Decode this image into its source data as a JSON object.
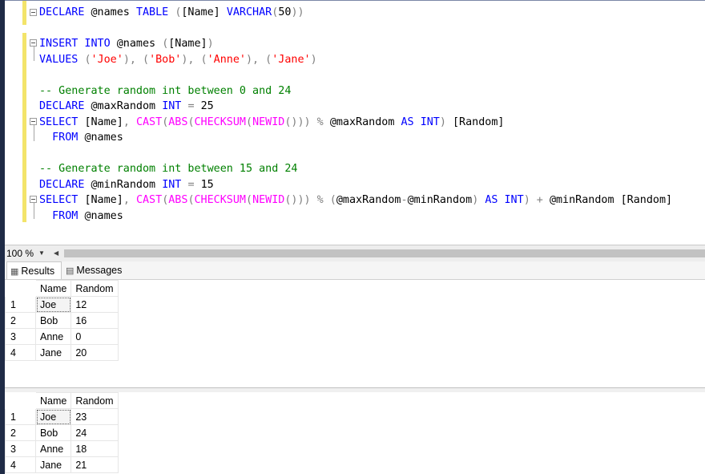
{
  "editor": {
    "lines": [
      [
        {
          "t": "DECLARE ",
          "c": "kw"
        },
        {
          "t": "@names ",
          "c": "ids"
        },
        {
          "t": "TABLE ",
          "c": "kw"
        },
        {
          "t": "(",
          "c": "op"
        },
        {
          "t": "[Name] ",
          "c": "ids"
        },
        {
          "t": "VARCHAR",
          "c": "kw"
        },
        {
          "t": "(",
          "c": "op"
        },
        {
          "t": "50",
          "c": "ids"
        },
        {
          "t": "))",
          "c": "op"
        }
      ],
      [],
      [
        {
          "t": "INSERT INTO ",
          "c": "kw"
        },
        {
          "t": "@names ",
          "c": "ids"
        },
        {
          "t": "(",
          "c": "op"
        },
        {
          "t": "[Name]",
          "c": "ids"
        },
        {
          "t": ")",
          "c": "op"
        }
      ],
      [
        {
          "t": "VALUES ",
          "c": "kw"
        },
        {
          "t": "(",
          "c": "op"
        },
        {
          "t": "'Joe'",
          "c": "str"
        },
        {
          "t": "), (",
          "c": "op"
        },
        {
          "t": "'Bob'",
          "c": "str"
        },
        {
          "t": "), (",
          "c": "op"
        },
        {
          "t": "'Anne'",
          "c": "str"
        },
        {
          "t": "), (",
          "c": "op"
        },
        {
          "t": "'Jane'",
          "c": "str"
        },
        {
          "t": ")",
          "c": "op"
        }
      ],
      [],
      [
        {
          "t": "-- Generate random int between 0 and 24",
          "c": "cm"
        }
      ],
      [
        {
          "t": "DECLARE ",
          "c": "kw"
        },
        {
          "t": "@maxRandom ",
          "c": "ids"
        },
        {
          "t": "INT ",
          "c": "kw"
        },
        {
          "t": "= ",
          "c": "op"
        },
        {
          "t": "25",
          "c": "ids"
        }
      ],
      [
        {
          "t": "SELECT ",
          "c": "kw"
        },
        {
          "t": "[Name]",
          "c": "ids"
        },
        {
          "t": ", ",
          "c": "op"
        },
        {
          "t": "CAST",
          "c": "fn"
        },
        {
          "t": "(",
          "c": "op"
        },
        {
          "t": "ABS",
          "c": "fn"
        },
        {
          "t": "(",
          "c": "op"
        },
        {
          "t": "CHECKSUM",
          "c": "fn"
        },
        {
          "t": "(",
          "c": "op"
        },
        {
          "t": "NEWID",
          "c": "fn"
        },
        {
          "t": "())) % ",
          "c": "op"
        },
        {
          "t": "@maxRandom ",
          "c": "ids"
        },
        {
          "t": "AS ",
          "c": "kw"
        },
        {
          "t": "INT",
          "c": "kw"
        },
        {
          "t": ") ",
          "c": "op"
        },
        {
          "t": "[Random]",
          "c": "ids"
        }
      ],
      [
        {
          "t": "  FROM ",
          "c": "kw"
        },
        {
          "t": "@names",
          "c": "ids"
        }
      ],
      [],
      [
        {
          "t": "-- Generate random int between 15 and 24",
          "c": "cm"
        }
      ],
      [
        {
          "t": "DECLARE ",
          "c": "kw"
        },
        {
          "t": "@minRandom ",
          "c": "ids"
        },
        {
          "t": "INT ",
          "c": "kw"
        },
        {
          "t": "= ",
          "c": "op"
        },
        {
          "t": "15",
          "c": "ids"
        }
      ],
      [
        {
          "t": "SELECT ",
          "c": "kw"
        },
        {
          "t": "[Name]",
          "c": "ids"
        },
        {
          "t": ", ",
          "c": "op"
        },
        {
          "t": "CAST",
          "c": "fn"
        },
        {
          "t": "(",
          "c": "op"
        },
        {
          "t": "ABS",
          "c": "fn"
        },
        {
          "t": "(",
          "c": "op"
        },
        {
          "t": "CHECKSUM",
          "c": "fn"
        },
        {
          "t": "(",
          "c": "op"
        },
        {
          "t": "NEWID",
          "c": "fn"
        },
        {
          "t": "())) % (",
          "c": "op"
        },
        {
          "t": "@maxRandom",
          "c": "ids"
        },
        {
          "t": "-",
          "c": "op"
        },
        {
          "t": "@minRandom",
          "c": "ids"
        },
        {
          "t": ") ",
          "c": "op"
        },
        {
          "t": "AS ",
          "c": "kw"
        },
        {
          "t": "INT",
          "c": "kw"
        },
        {
          "t": ") + ",
          "c": "op"
        },
        {
          "t": "@minRandom ",
          "c": "ids"
        },
        {
          "t": "[Random]",
          "c": "ids"
        }
      ],
      [
        {
          "t": "  FROM ",
          "c": "kw"
        },
        {
          "t": "@names",
          "c": "ids"
        }
      ]
    ]
  },
  "zoom": {
    "value": "100 %"
  },
  "tabs": {
    "results_label": "Results",
    "messages_label": "Messages",
    "results_icon": "grid-icon",
    "messages_icon": "messages-icon"
  },
  "results": [
    {
      "columns": [
        "Name",
        "Random"
      ],
      "rows": [
        [
          "1",
          "Joe",
          "12"
        ],
        [
          "2",
          "Bob",
          "16"
        ],
        [
          "3",
          "Anne",
          "0"
        ],
        [
          "4",
          "Jane",
          "20"
        ]
      ]
    },
    {
      "columns": [
        "Name",
        "Random"
      ],
      "rows": [
        [
          "1",
          "Joe",
          "23"
        ],
        [
          "2",
          "Bob",
          "24"
        ],
        [
          "3",
          "Anne",
          "18"
        ],
        [
          "4",
          "Jane",
          "21"
        ]
      ]
    }
  ],
  "colors": {
    "keyword": "#0000ff",
    "function": "#ff00ff",
    "string": "#ff0000",
    "comment": "#008000",
    "operator": "#808080",
    "changebar": "#f3e46a",
    "window_border": "#1f2b46"
  }
}
